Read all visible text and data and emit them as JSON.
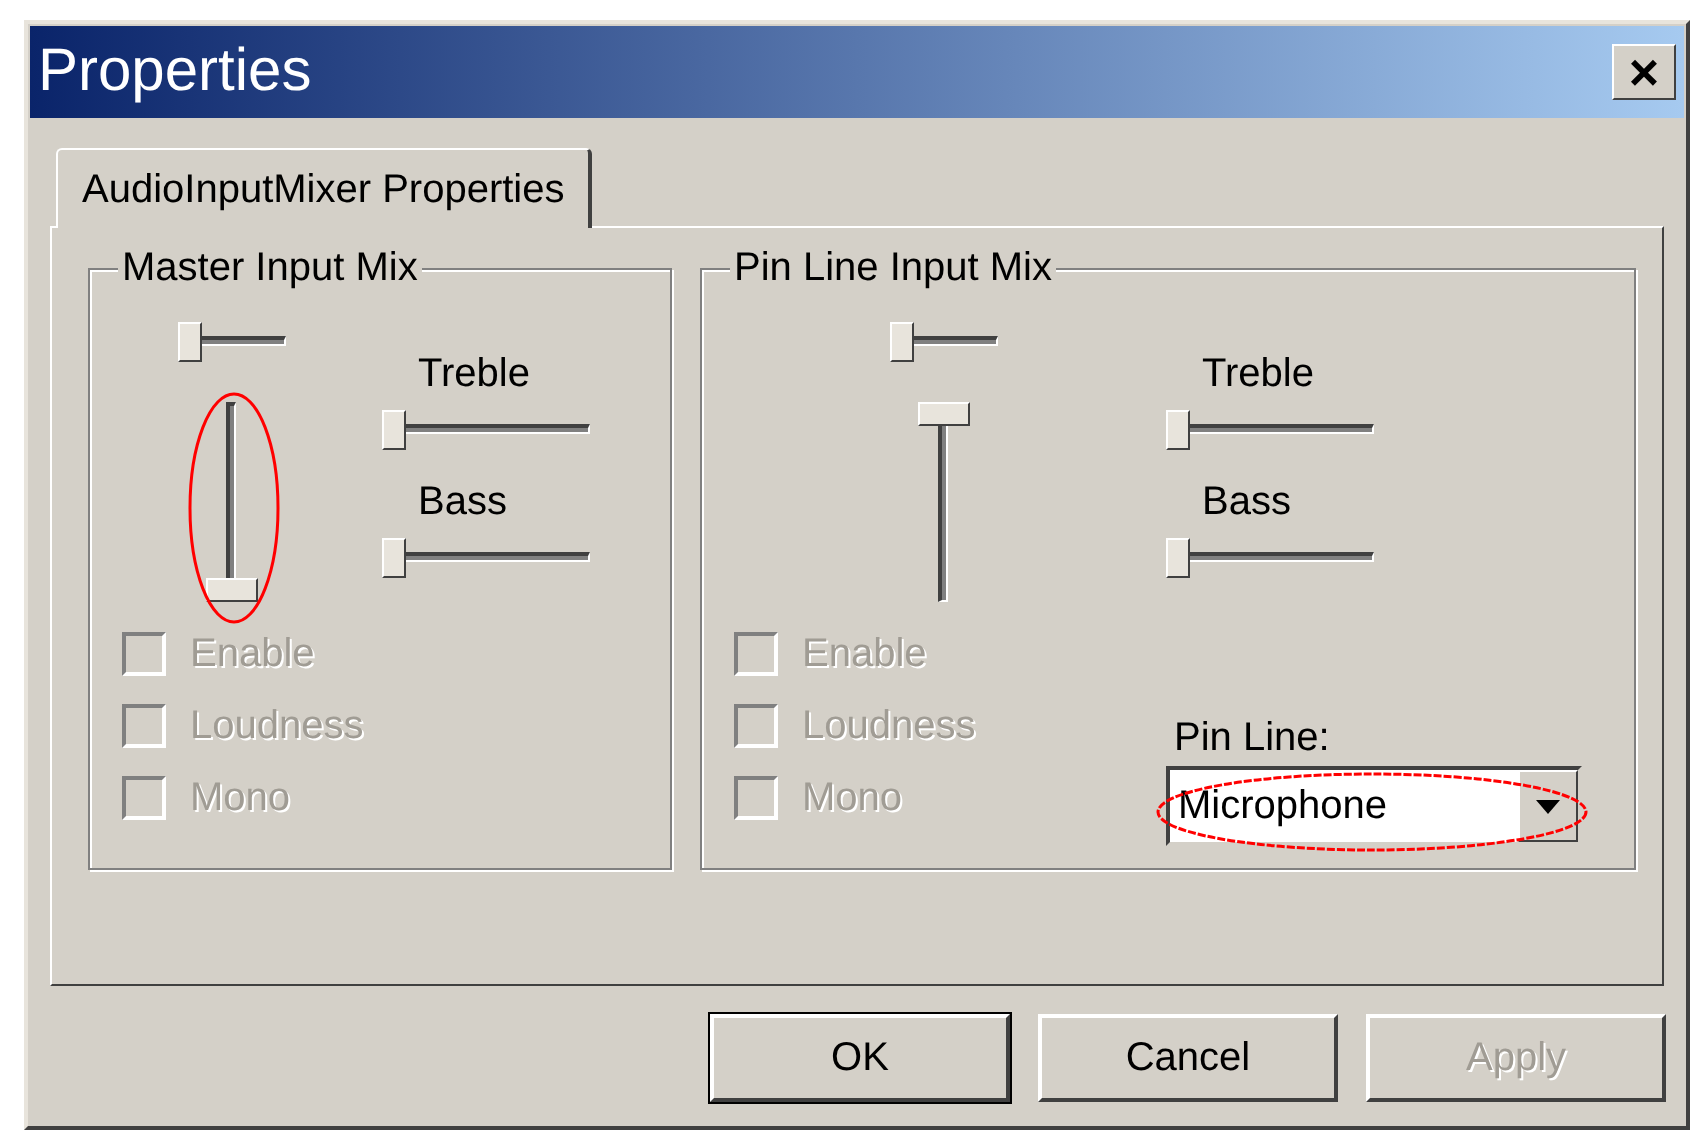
{
  "window": {
    "title": "Properties",
    "close": "×"
  },
  "tabs": [
    {
      "label": "AudioInputMixer Properties",
      "selected": true
    }
  ],
  "groups": [
    {
      "title": "Master Input Mix",
      "balance": {
        "level": 0
      },
      "volume": {
        "level": 0,
        "highlighted": true
      },
      "tone": [
        {
          "label": "Treble",
          "level": 0
        },
        {
          "label": "Bass",
          "level": 0
        }
      ],
      "checkboxes": [
        {
          "label": "Enable",
          "checked": false,
          "disabled": true
        },
        {
          "label": "Loudness",
          "checked": false,
          "disabled": true
        },
        {
          "label": "Mono",
          "checked": false,
          "disabled": true
        }
      ]
    },
    {
      "title": "Pin Line Input Mix",
      "balance": {
        "level": 0
      },
      "volume": {
        "level": 1,
        "highlighted": false
      },
      "tone": [
        {
          "label": "Treble",
          "level": 0
        },
        {
          "label": "Bass",
          "level": 0
        }
      ],
      "checkboxes": [
        {
          "label": "Enable",
          "checked": false,
          "disabled": true
        },
        {
          "label": "Loudness",
          "checked": false,
          "disabled": true
        },
        {
          "label": "Mono",
          "checked": false,
          "disabled": true
        }
      ],
      "pin_line": {
        "label": "Pin Line:",
        "value": "Microphone",
        "highlighted": true
      }
    }
  ],
  "buttons": [
    {
      "label": "OK",
      "default": true,
      "disabled": false
    },
    {
      "label": "Cancel",
      "default": false,
      "disabled": false
    },
    {
      "label": "Apply",
      "default": false,
      "disabled": true
    }
  ]
}
